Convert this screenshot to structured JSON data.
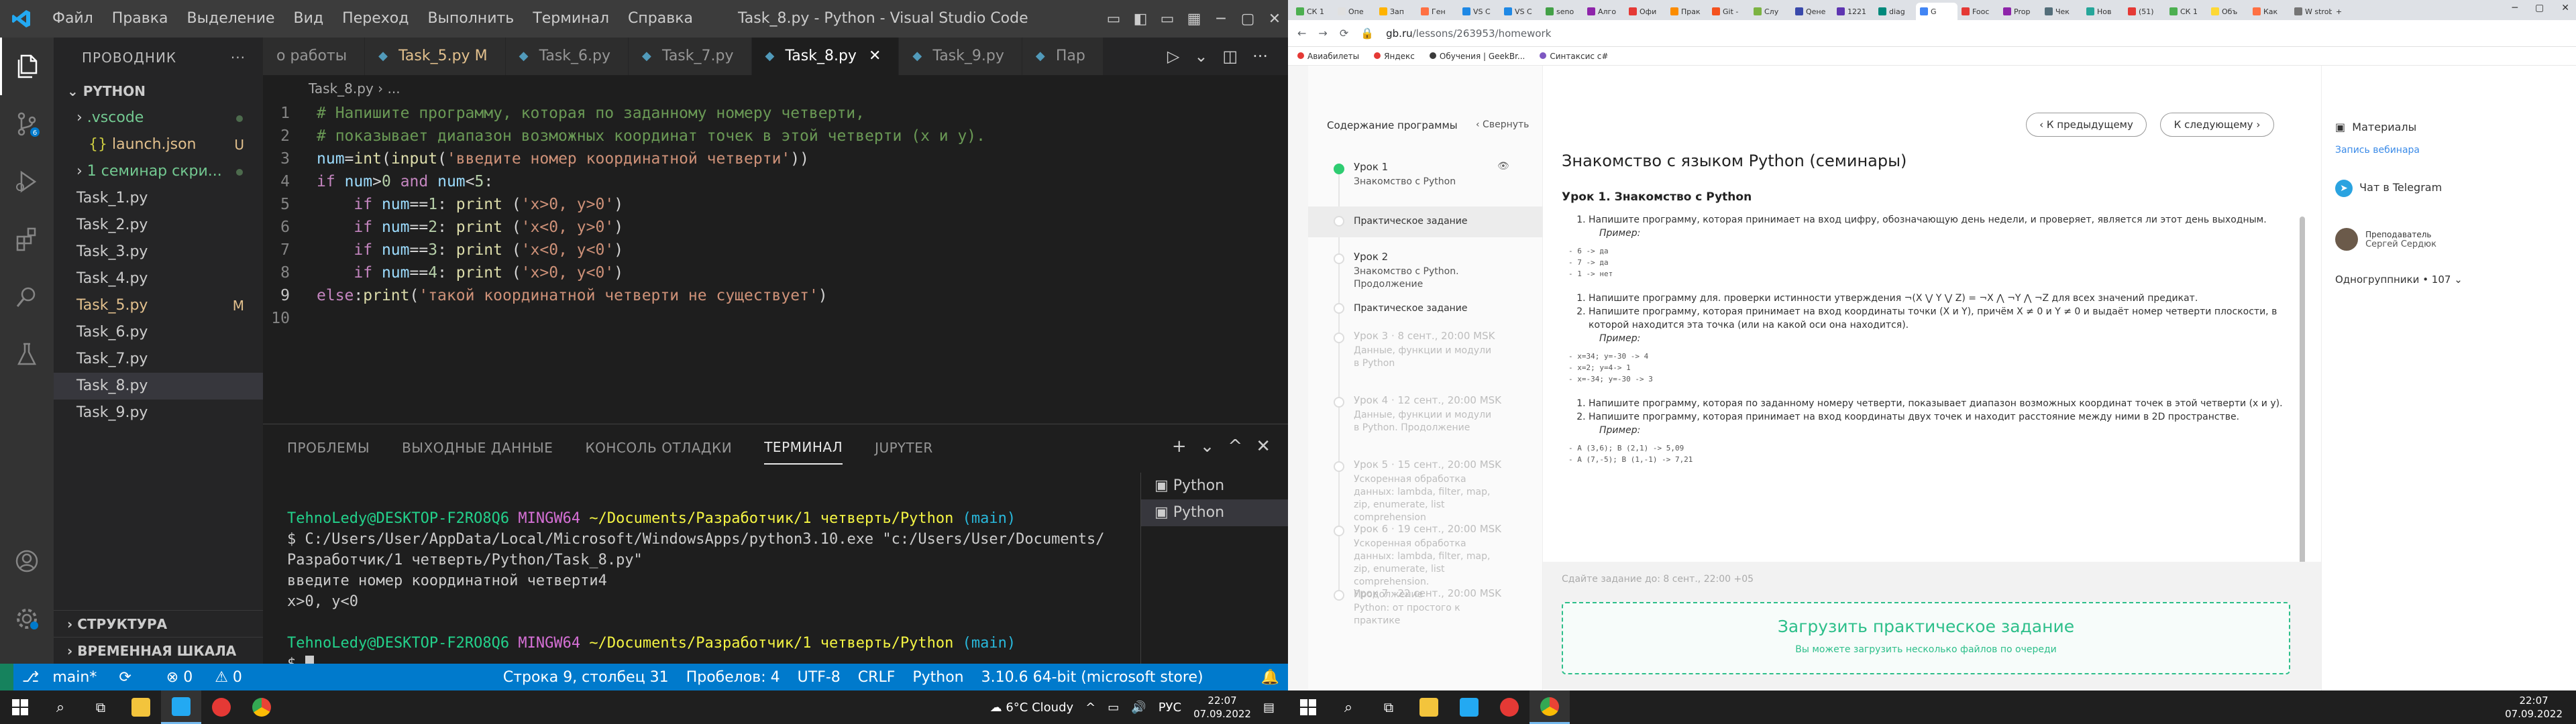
{
  "vscode": {
    "menu": [
      "Файл",
      "Правка",
      "Выделение",
      "Вид",
      "Переход",
      "Выполнить",
      "Терминал",
      "Справка"
    ],
    "title": "Task_8.py - Python - Visual Studio Code",
    "explorer": {
      "header": "ПРОВОДНИК",
      "folder": "PYTHON",
      "items": [
        {
          "label": ".vscode",
          "indent": 1,
          "state": "green"
        },
        {
          "label": "launch.json",
          "indent": 2,
          "state": "mod",
          "badge": "U"
        },
        {
          "label": "1 семинар скри...",
          "indent": 1,
          "state": "green"
        },
        {
          "label": "Task_1.py",
          "indent": 1,
          "state": ""
        },
        {
          "label": "Task_2.py",
          "indent": 1,
          "state": ""
        },
        {
          "label": "Task_3.py",
          "indent": 1,
          "state": ""
        },
        {
          "label": "Task_4.py",
          "indent": 1,
          "state": ""
        },
        {
          "label": "Task_5.py",
          "indent": 1,
          "state": "mod",
          "badge": "M"
        },
        {
          "label": "Task_6.py",
          "indent": 1,
          "state": ""
        },
        {
          "label": "Task_7.py",
          "indent": 1,
          "state": ""
        },
        {
          "label": "Task_8.py",
          "indent": 1,
          "state": "sel"
        },
        {
          "label": "Task_9.py",
          "indent": 1,
          "state": ""
        }
      ],
      "structure": "СТРУКТУРА",
      "timeline": "ВРЕМЕННАЯ ШКАЛА"
    },
    "tabs": [
      {
        "label": "о работы",
        "state": ""
      },
      {
        "label": "Task_5.py M",
        "state": "modified"
      },
      {
        "label": "Task_6.py",
        "state": ""
      },
      {
        "label": "Task_7.py",
        "state": ""
      },
      {
        "label": "Task_8.py",
        "state": "active"
      },
      {
        "label": "Task_9.py",
        "state": ""
      },
      {
        "label": "Пар",
        "state": ""
      }
    ],
    "breadcrumb": "Task_8.py › ...",
    "code_lines": [
      "# Напишите программу, которая по заданному номеру четверти,",
      "# показывает диапазон возможных координат точек в этой четверти (x и y).",
      "num=int(input('введите номер координатной четверти'))",
      "if num>0 and num<5:",
      "    if num==1: print ('x>0, y>0')",
      "    if num==2: print ('x<0, y>0')",
      "    if num==3: print ('x<0, y<0')",
      "    if num==4: print ('x>0, y<0')",
      "else:print('такой координатной четверти не существует')",
      ""
    ],
    "panel_tabs": [
      "ПРОБЛЕМЫ",
      "ВЫХОДНЫЕ ДАННЫЕ",
      "КОНСОЛЬ ОТЛАДКИ",
      "ТЕРМИНАЛ",
      "JUPYTER"
    ],
    "terminal": {
      "user": "TehnoLedy@DESKTOP-F2RO8Q6",
      "shell": "MINGW64",
      "path": "~/Documents/Разработчик/1 четверть/Python",
      "branch": "(main)",
      "cmd1": "$ C:/Users/User/AppData/Local/Microsoft/WindowsApps/python3.10.exe \"c:/Users/User/Documents/Разработчик/1 четверть/Python/Task_8.py\"",
      "out1": "введите номер координатной четверти4",
      "out2": "x>0, y<0",
      "prompt": "$ ",
      "list": [
        "Python",
        "Python"
      ]
    },
    "status": {
      "branch": "main*",
      "sync": "⟳",
      "errors": "⊗ 0",
      "warnings": "⚠ 0",
      "position": "Строка 9, столбец 31",
      "spaces": "Пробелов: 4",
      "encoding": "UTF-8",
      "eol": "CRLF",
      "language": "Python",
      "interpreter": "3.10.6 64-bit (microsoft store)"
    }
  },
  "browser": {
    "tabs": [
      "СК 1",
      "Опе",
      "Зап",
      "Ген",
      "VS C",
      "VS C",
      "seno",
      "Алго",
      "Офи",
      "Прак",
      "Git -",
      "Слу",
      "Qене",
      "1221",
      "diag",
      "G",
      "Fooc",
      "Prop",
      "Чек",
      "Нов",
      "(51)",
      "СК 1",
      "Объ",
      "Как",
      "W strob",
      "+"
    ],
    "url_host": "gb.ru",
    "url_path": "/lessons/263953/homework",
    "bookmarks": [
      "Авиабилеты",
      "Яндекс",
      "Обучения | GeekBr...",
      "Синтаксис c#"
    ]
  },
  "gb": {
    "nav_title": "Содержание программы",
    "collapse": "‹ Свернуть",
    "lessons": [
      {
        "num": "Урок 1",
        "name": "Знакомство с Python",
        "dim": false,
        "done": true
      },
      {
        "num": "Урок 2",
        "name": "Знакомство с Python. Продолжение",
        "dim": false,
        "done": false
      },
      {
        "num": "Урок 3 · 8 сент., 20:00 MSK",
        "name": "Данные, функции и модули в Python",
        "dim": true,
        "done": false
      },
      {
        "num": "Урок 4 · 12 сент., 20:00 MSK",
        "name": "Данные, функции и модули в Python. Продолжение",
        "dim": true,
        "done": false
      },
      {
        "num": "Урок 5 · 15 сент., 20:00 MSK",
        "name": "Ускоренная обработка данных: lambda, filter, map, zip, enumerate, list comprehension",
        "dim": true,
        "done": false
      },
      {
        "num": "Урок 6 · 19 сент., 20:00 MSK",
        "name": "Ускоренная обработка данных: lambda, filter, map, zip, enumerate, list comprehension. Продолжение",
        "dim": true,
        "done": false
      },
      {
        "num": "Урок 7 · 22 сент., 20:00 MSK",
        "name": "Python: от простого к практике",
        "dim": true,
        "done": false
      }
    ],
    "practice": "Практическое задание",
    "prev_btn": "‹  К предыдущему",
    "next_btn": "К следующему  ›",
    "title": "Знакомство с языком Python (семинары)",
    "subtitle": "Урок 1. Знакомство с Python",
    "tasks1": [
      "Напишите программу, которая принимает на вход цифру, обозначающую день недели, и проверяет, является ли этот день выходным."
    ],
    "example": "Пример:",
    "code1": "- 6 -> да\n- 7 -> да\n- 1 -> нет",
    "tasks2": [
      "Напишите программу для. проверки истинности утверждения ¬(X ⋁ Y ⋁ Z) = ¬X ⋀ ¬Y ⋀ ¬Z для всех значений предикат.",
      "Напишите программу, которая принимает на вход координаты точки (X и Y), причём X ≠ 0 и Y ≠ 0 и выдаёт номер четверти плоскости, в которой находится эта точка (или на какой оси она находится)."
    ],
    "code2": "- x=34; y=-30 -> 4\n- x=2; y=4-> 1\n- x=-34; y=-30 -> 3",
    "tasks3": [
      "Напишите программу, которая по заданному номеру четверти, показывает диапазон возможных координат точек в этой четверти (x и y).",
      "Напишите программу, которая принимает на вход координаты двух точек и находит расстояние между ними в 2D пространстве."
    ],
    "code3": "- A (3,6); B (2,1) -> 5,09\n- A (7,-5); B (1,-1) -> 7,21",
    "deadline": "Сдайте задание до: 8 сент., 22:00 +05",
    "upload_title": "Загрузить практическое задание",
    "upload_hint": "Вы можете загрузить несколько файлов по очереди",
    "right": {
      "materials": "Материалы",
      "recording": "Запись вебинара",
      "telegram": "Чат в Telegram",
      "teacher_role": "Преподаватель",
      "teacher_name": "Сергей Сердюк",
      "groupmates": "Одногруппники • 107"
    }
  },
  "taskbar_left": {
    "weather": "6°C Cloudy",
    "lang": "РУС",
    "time": "22:07",
    "date": "07.09.2022"
  },
  "taskbar_right": {
    "time": "22:07",
    "date": "07.09.2022"
  }
}
